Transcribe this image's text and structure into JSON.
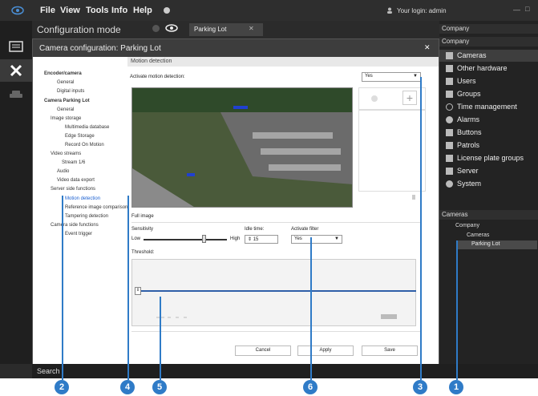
{
  "menu": {
    "file": "File",
    "view": "View",
    "tools": "Tools",
    "info": "Info",
    "help": "Help"
  },
  "login": "Your login: admin",
  "mode_title": "Configuration mode",
  "tab": {
    "label": "Parking Lot"
  },
  "dialog_title": "Camera configuration: Parking Lot",
  "tree": {
    "encoder": "Encoder/camera",
    "general": "General",
    "digital_inputs": "Digital inputs",
    "camera": "Camera Parking Lot",
    "general2": "General",
    "image_storage": "Image storage",
    "multimedia": "Multimedia database",
    "edge": "Edge Storage",
    "record": "Record On Motion",
    "video_streams": "Video streams",
    "stream": "Stream 1/6",
    "audio": "Audio",
    "video_export": "Video data export",
    "server_side": "Server side functions",
    "motion": "Motion detection",
    "reference": "Reference image comparison",
    "tampering": "Tampering detection",
    "camera_side": "Camera side functions",
    "event_trigger": "Event trigger"
  },
  "panel": {
    "title": "Motion detection",
    "activate_label": "Activate motion detection:",
    "activate_value": "Yes",
    "full_image": "Full image",
    "sensitivity": "Sensitivity",
    "low": "Low",
    "high": "High",
    "sensitivity_level": 0.72,
    "idle_label": "Idle time:",
    "idle_value": "15",
    "filter_label": "Activate filter",
    "filter_value": "Yes",
    "threshold": "Threshold:",
    "cancel": "Cancel",
    "apply": "Apply",
    "save": "Save"
  },
  "right": {
    "company1": "Company",
    "company2": "Company",
    "items": [
      "Cameras",
      "Other hardware",
      "Users",
      "Groups",
      "Time management",
      "Alarms",
      "Buttons",
      "Patrols",
      "License plate groups",
      "Server",
      "System"
    ],
    "cameras_hdr": "Cameras",
    "tree": [
      "Company",
      "Cameras",
      "Parking Lot"
    ]
  },
  "status": {
    "search": "Search"
  },
  "callouts": [
    "1",
    "2",
    "3",
    "4",
    "5",
    "6"
  ],
  "colors": {
    "accent": "#2f7bc7",
    "selection": "#1a5fd0"
  }
}
